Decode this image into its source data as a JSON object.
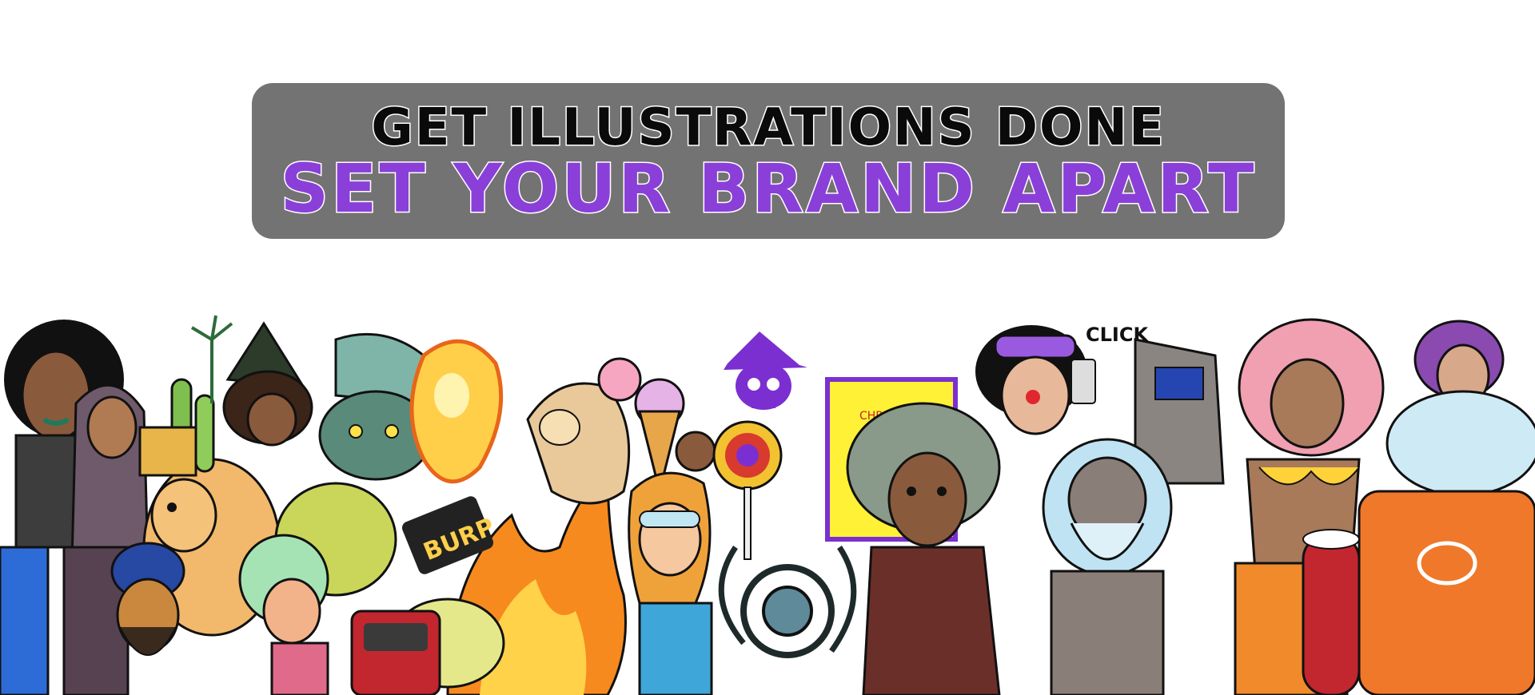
{
  "banner": {
    "headline": "GET ILLUSTRATIONS DONE",
    "tagline": "SET YOUR BRAND APART",
    "background_color": "#737373",
    "tagline_color": "#8a3fd9"
  },
  "collage": {
    "burp_text": "BURP",
    "click_text": "CLICK",
    "sign_letters": "CHR",
    "logo_icon": "witch-hat-skull-icon",
    "accent_color": "#7b2fd0"
  }
}
